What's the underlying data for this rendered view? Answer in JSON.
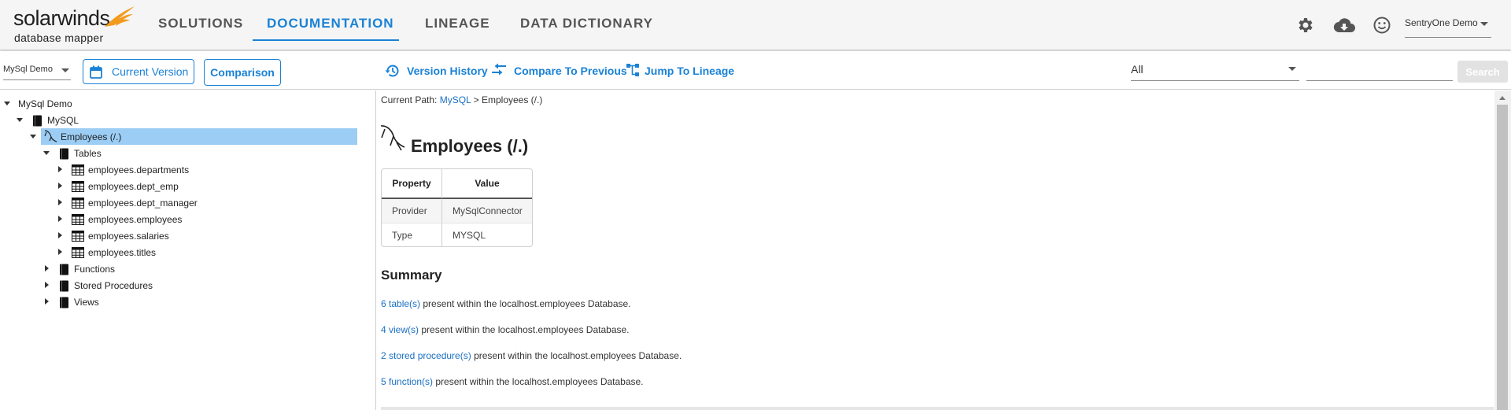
{
  "brand": {
    "name": "solarwinds",
    "product": "database mapper",
    "accent": "#1a82d6",
    "bird_color": "#f39a1e"
  },
  "nav": {
    "tabs": [
      {
        "label": "SOLUTIONS"
      },
      {
        "label": "DOCUMENTATION",
        "active": true
      },
      {
        "label": "LINEAGE"
      },
      {
        "label": "DATA DICTIONARY"
      }
    ],
    "icons": [
      "gear-icon",
      "cloud-download-icon",
      "smiley-icon"
    ],
    "user": "SentryOne Demo"
  },
  "toolbar": {
    "database": "MySql Demo",
    "current_version": "Current Version",
    "comparison": "Comparison",
    "version_history": "Version History",
    "compare_previous": "Compare To Previous",
    "jump_lineage": "Jump To Lineage",
    "filter": "All",
    "search_value": "",
    "search_label": "Search"
  },
  "tree": {
    "root": "MySql Demo",
    "server": "MySQL",
    "database": "Employees (/.)",
    "tables_folder": "Tables",
    "tables": [
      "employees.departments",
      "employees.dept_emp",
      "employees.dept_manager",
      "employees.employees",
      "employees.salaries",
      "employees.titles"
    ],
    "folders": [
      "Functions",
      "Stored Procedures",
      "Views"
    ]
  },
  "content": {
    "breadcrumb_prefix": "Current Path:",
    "breadcrumb_link": "MySQL",
    "breadcrumb_sep": ">",
    "breadcrumb_current": "Employees (/.)",
    "title": "Employees (/.)",
    "table_headers": [
      "Property",
      "Value"
    ],
    "properties": [
      {
        "property": "Provider",
        "value": "MySqlConnector"
      },
      {
        "property": "Type",
        "value": "MYSQL"
      }
    ],
    "summary_heading": "Summary",
    "summary": [
      {
        "link": "6 table(s)",
        "text": " present within the localhost.employees Database."
      },
      {
        "link": "4 view(s)",
        "text": " present within the localhost.employees Database."
      },
      {
        "link": "2 stored procedure(s)",
        "text": " present within the localhost.employees Database."
      },
      {
        "link": "5 function(s)",
        "text": " present within the localhost.employees Database."
      }
    ]
  }
}
